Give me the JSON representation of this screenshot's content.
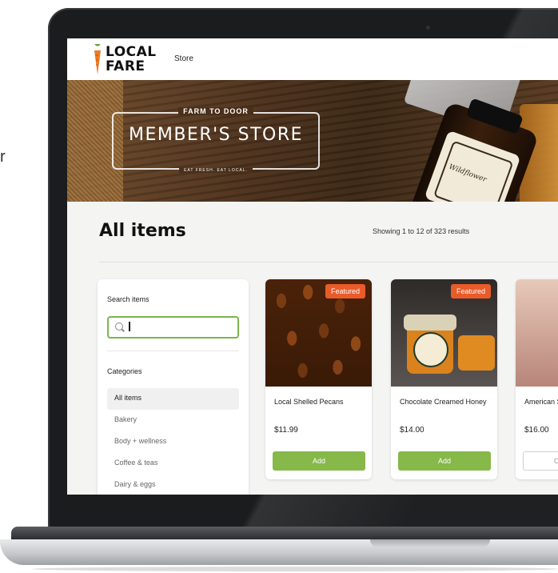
{
  "stray_text": "r",
  "header": {
    "logo_line1": "LOCAL",
    "logo_line2": "FARE",
    "nav_store": "Store"
  },
  "hero": {
    "tagline": "FARM TO DOOR",
    "title": "MEMBER'S STORE",
    "subtitle": "EAT FRESH. EAT LOCAL.",
    "jar_text": "Wildflower"
  },
  "listing": {
    "title": "All items",
    "result_count": "Showing 1 to 12 of 323 results"
  },
  "sidebar": {
    "search_label": "Search items",
    "search_value": "",
    "categories_heading": "Categories",
    "categories": [
      {
        "label": "All items",
        "active": true
      },
      {
        "label": "Bakery",
        "active": false
      },
      {
        "label": "Body + wellness",
        "active": false
      },
      {
        "label": "Coffee & teas",
        "active": false
      },
      {
        "label": "Dairy & eggs",
        "active": false
      }
    ]
  },
  "products": [
    {
      "name": "Local Shelled Pecans",
      "price": "$11.99",
      "badge": "Featured",
      "button": "Add"
    },
    {
      "name": "Chocolate Creamed Honey",
      "price": "$14.00",
      "badge": "Featured",
      "button": "Add"
    },
    {
      "name": "American Scrub",
      "price": "$16.00",
      "badge": "",
      "button": "Ou"
    }
  ],
  "colors": {
    "accent_green": "#86b84a",
    "search_border": "#7bb54a",
    "badge_orange": "#ea5b2a"
  },
  "icons": {
    "search": "magnifier-icon",
    "logo": "carrot-icon"
  }
}
